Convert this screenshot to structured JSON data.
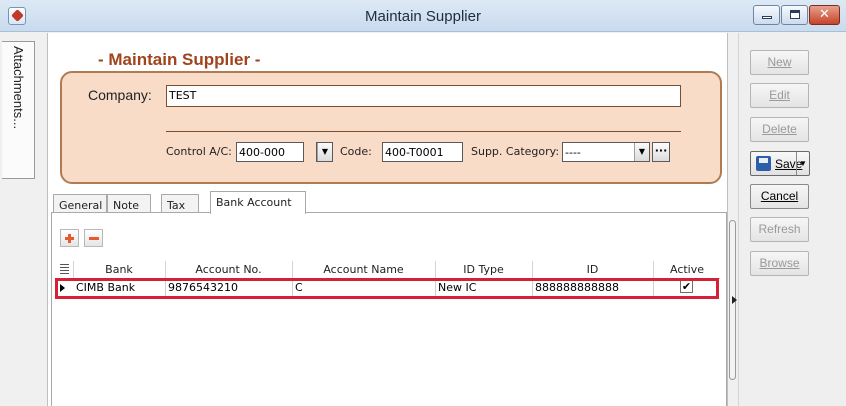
{
  "window": {
    "title": "Maintain Supplier"
  },
  "left_tabs": {
    "attachments": "Attachments..."
  },
  "form": {
    "heading": "- Maintain Supplier -",
    "company_label": "Company:",
    "company_value": "TEST",
    "control_ac_label": "Control A/C:",
    "control_ac_value": "400-000",
    "code_label": "Code:",
    "code_value": "400-T0001",
    "supp_category_label": "Supp. Category:",
    "supp_category_value": "----"
  },
  "tabs": [
    {
      "label": "General"
    },
    {
      "label": "Note"
    },
    {
      "label": "Tax"
    },
    {
      "label": "Bank Account",
      "active": true
    }
  ],
  "grid": {
    "columns": [
      "Bank",
      "Account No.",
      "Account Name",
      "ID Type",
      "ID",
      "Active"
    ],
    "rows": [
      {
        "bank": "CIMB Bank",
        "account_no": "9876543210",
        "account_name": "C",
        "id_type": "New IC",
        "id": "888888888888",
        "active": true
      }
    ]
  },
  "sidebar": {
    "new": "New",
    "edit": "Edit",
    "delete": "Delete",
    "save": "Save",
    "cancel": "Cancel",
    "refresh": "Refresh",
    "browse": "Browse"
  },
  "colors": {
    "heading": "#a0441d",
    "company_panel": "#f8dcc8",
    "row_highlight": "#d62035"
  }
}
